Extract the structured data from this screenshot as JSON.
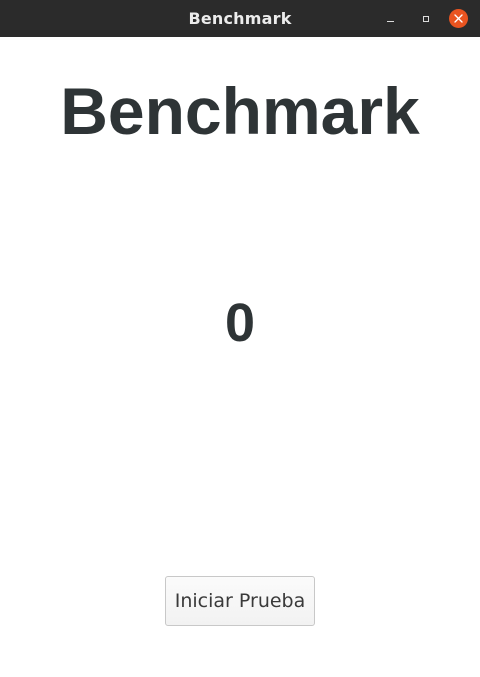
{
  "window": {
    "title": "Benchmark",
    "controls": {
      "minimize": "minimize-icon",
      "maximize": "maximize-icon",
      "close": "close-icon"
    },
    "close_color": "#e95420"
  },
  "main": {
    "heading": "Benchmark",
    "counter": "0",
    "start_button_label": "Iniciar Prueba"
  }
}
